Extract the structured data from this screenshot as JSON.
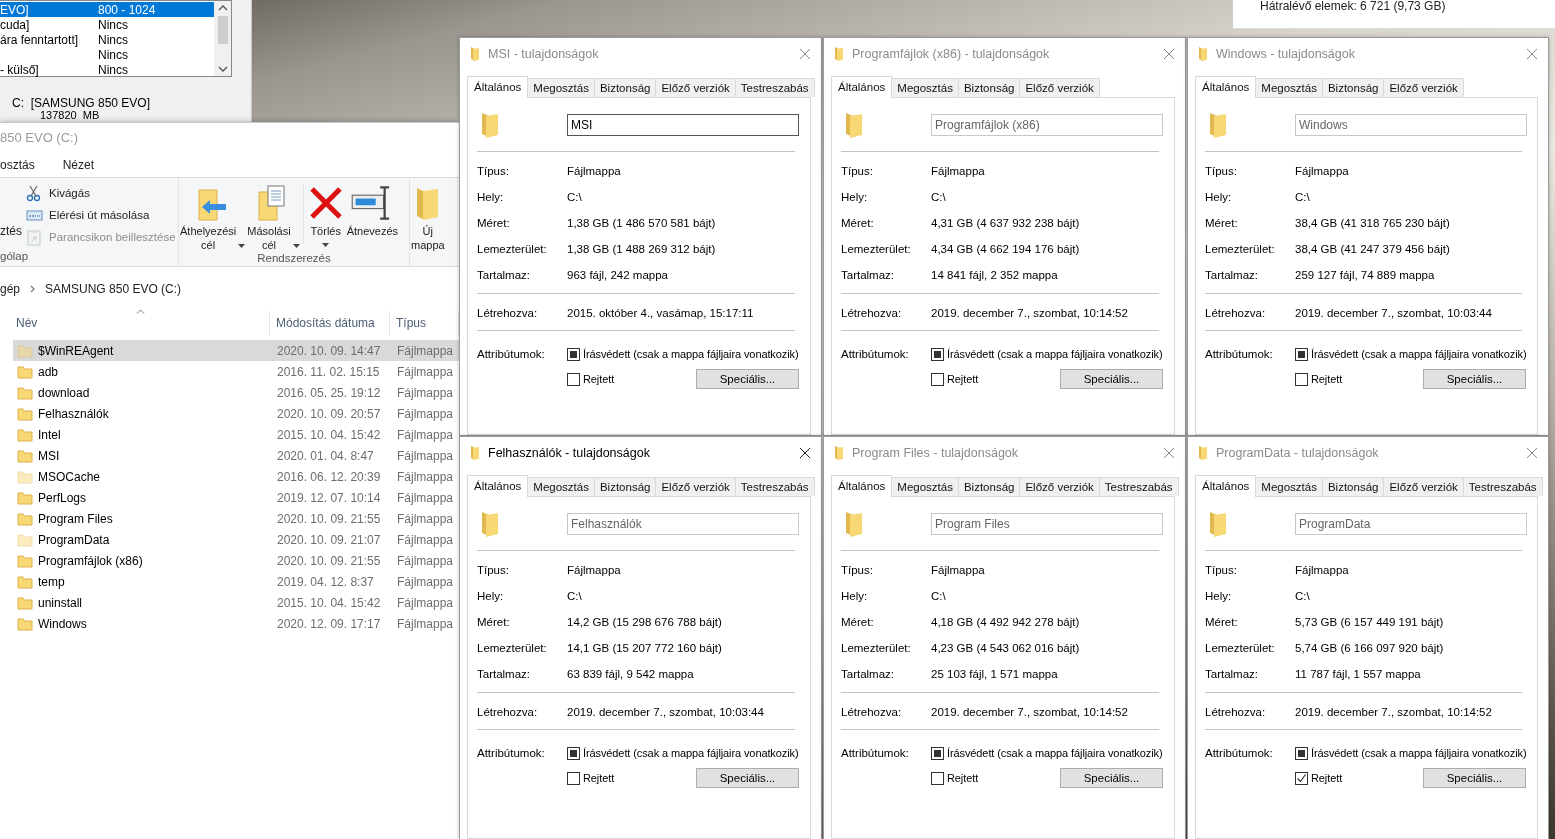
{
  "disk_window": {
    "rows": [
      {
        "column_1": "EVO]",
        "column_2": "800 - 1024",
        "selected": true
      },
      {
        "column_1": "cuda]",
        "column_2": "Nincs",
        "selected": false
      },
      {
        "column_1": "ára fenntartott]",
        "column_2": "Nincs",
        "selected": false
      },
      {
        "column_2": "Nincs",
        "selected": false
      },
      {
        "column_1": "- külső]",
        "column_2": "Nincs",
        "selected": false
      }
    ],
    "drive_label": "C:  [SAMSUNG 850 EVO]",
    "drive_size": "137820  MB"
  },
  "progress_window": {
    "text": "Hátralévő elemek: 6 721 (9,73 GB)"
  },
  "explorer": {
    "title": "850 EVO (C:)",
    "ribbon_tabs": [
      "osztás",
      "Nézet"
    ],
    "ribbon": {
      "clipboard": {
        "partial_button": "ztés",
        "items": [
          {
            "kind": "cut",
            "label": "Kivágás",
            "disabled": false
          },
          {
            "kind": "copy-path",
            "label": "Elérési út másolása",
            "disabled": false
          },
          {
            "kind": "paste-shortcut",
            "label": "Parancsikon beillesztése",
            "disabled": true
          }
        ],
        "group_label": "gólap"
      },
      "organize": {
        "buttons": [
          {
            "kind": "move",
            "label": "Áthelyezési cél",
            "dropdown": true
          },
          {
            "kind": "copy",
            "label": "Másolási cél",
            "dropdown": true
          },
          {
            "kind": "delete",
            "label": "Törlés",
            "dropdown": true
          },
          {
            "kind": "rename",
            "label": "Átnevezés",
            "dropdown": false
          }
        ],
        "group_label": "Rendszerezés"
      },
      "new": {
        "buttons": [
          {
            "kind": "new-folder",
            "label": "Új mappa",
            "dropdown": false
          }
        ]
      }
    },
    "address": [
      "gép",
      "SAMSUNG 850 EVO (C:)"
    ],
    "columns": [
      {
        "label": "Név",
        "sorted": true
      },
      {
        "label": "Módosítás dátuma",
        "sorted": false
      },
      {
        "label": "Típus",
        "sorted": false
      }
    ],
    "rows": [
      {
        "name": "$WinREAgent",
        "date": "2020. 10. 09. 14:47",
        "type": "Fájlmappa",
        "hidden": true,
        "selected": true
      },
      {
        "name": "adb",
        "date": "2016. 11. 02. 15:15",
        "type": "Fájlmappa",
        "hidden": false,
        "selected": false
      },
      {
        "name": "download",
        "date": "2016. 05. 25. 19:12",
        "type": "Fájlmappa",
        "hidden": false,
        "selected": false
      },
      {
        "name": "Felhasználók",
        "date": "2020. 10. 09. 20:57",
        "type": "Fájlmappa",
        "hidden": false,
        "selected": false
      },
      {
        "name": "Intel",
        "date": "2015. 10. 04. 15:42",
        "type": "Fájlmappa",
        "hidden": false,
        "selected": false
      },
      {
        "name": "MSI",
        "date": "2020. 01. 04. 8:47",
        "type": "Fájlmappa",
        "hidden": false,
        "selected": false
      },
      {
        "name": "MSOCache",
        "date": "2016. 06. 12. 20:39",
        "type": "Fájlmappa",
        "hidden": true,
        "selected": false
      },
      {
        "name": "PerfLogs",
        "date": "2019. 12. 07. 10:14",
        "type": "Fájlmappa",
        "hidden": false,
        "selected": false
      },
      {
        "name": "Program Files",
        "date": "2020. 10. 09. 21:55",
        "type": "Fájlmappa",
        "hidden": false,
        "selected": false
      },
      {
        "name": "ProgramData",
        "date": "2020. 10. 09. 21:07",
        "type": "Fájlmappa",
        "hidden": true,
        "selected": false
      },
      {
        "name": "Programfájlok (x86)",
        "date": "2020. 10. 09. 21:55",
        "type": "Fájlmappa",
        "hidden": false,
        "selected": false
      },
      {
        "name": "temp",
        "date": "2019. 04. 12. 8:37",
        "type": "Fájlmappa",
        "hidden": false,
        "selected": false
      },
      {
        "name": "uninstall",
        "date": "2015. 10. 04. 15:42",
        "type": "Fájlmappa",
        "hidden": false,
        "selected": false
      },
      {
        "name": "Windows",
        "date": "2020. 12. 09. 17:17",
        "type": "Fájlmappa",
        "hidden": false,
        "selected": false
      }
    ]
  },
  "dialogs": [
    {
      "title": "MSI - tulajdonságok",
      "active": false,
      "tabs": [
        {
          "label": "Általános",
          "selected": true
        },
        {
          "label": "Megosztás",
          "selected": false
        },
        {
          "label": "Biztonság",
          "selected": false
        },
        {
          "label": "Előző verziók",
          "selected": false
        },
        {
          "label": "Testreszabás",
          "selected": false
        }
      ],
      "name_value": "MSI",
      "name_focused": true,
      "details": [
        {
          "label": "Típus:",
          "value": "Fájlmappa"
        },
        {
          "label": "Hely:",
          "value": "C:\\"
        },
        {
          "label": "Méret:",
          "value": "1,38 GB (1 486 570 581 bájt)"
        },
        {
          "label": "Lemezterület:",
          "value": "1,38 GB (1 488 269 312 bájt)"
        },
        {
          "label": "Tartalmaz:",
          "value": "963 fájl, 242 mappa"
        }
      ],
      "created": {
        "label": "Létrehozva:",
        "value": "2015. október 4., vasámap, 15:17:11"
      },
      "attributes_label": "Attribútumok:",
      "readonly": {
        "label": "Írásvédett (csak a mappa fájljaira vonatkozik)",
        "indeterminate": true
      },
      "hidden_attr": {
        "label": "Rejtett",
        "checked": false
      },
      "advanced_button": "Speciális..."
    },
    {
      "title": "Programfájlok (x86) - tulajdonságok",
      "active": false,
      "tabs": [
        {
          "label": "Általános",
          "selected": true
        },
        {
          "label": "Megosztás",
          "selected": false
        },
        {
          "label": "Biztonság",
          "selected": false
        },
        {
          "label": "Előző verziók",
          "selected": false
        }
      ],
      "name_value": "Programfájlok (x86)",
      "name_focused": false,
      "details": [
        {
          "label": "Típus:",
          "value": "Fájlmappa"
        },
        {
          "label": "Hely:",
          "value": "C:\\"
        },
        {
          "label": "Méret:",
          "value": "4,31 GB (4 637 932 238 bájt)"
        },
        {
          "label": "Lemezterület:",
          "value": "4,34 GB (4 662 194 176 bájt)"
        },
        {
          "label": "Tartalmaz:",
          "value": "14 841 fájl, 2 352 mappa"
        }
      ],
      "created": {
        "label": "Létrehozva:",
        "value": "2019. december 7., szombat, 10:14:52"
      },
      "attributes_label": "Attribútumok:",
      "readonly": {
        "label": "Írásvédett (csak a mappa fájljaira vonatkozik)",
        "indeterminate": true
      },
      "hidden_attr": {
        "label": "Rejtett",
        "checked": false
      },
      "advanced_button": "Speciális..."
    },
    {
      "title": "Windows - tulajdonságok",
      "active": false,
      "tabs": [
        {
          "label": "Általános",
          "selected": true
        },
        {
          "label": "Megosztás",
          "selected": false
        },
        {
          "label": "Biztonság",
          "selected": false
        },
        {
          "label": "Előző verziók",
          "selected": false
        }
      ],
      "name_value": "Windows",
      "name_focused": false,
      "details": [
        {
          "label": "Típus:",
          "value": "Fájlmappa"
        },
        {
          "label": "Hely:",
          "value": "C:\\"
        },
        {
          "label": "Méret:",
          "value": "38,4 GB (41 318 765 230 bájt)"
        },
        {
          "label": "Lemezterület:",
          "value": "38,4 GB (41 247 379 456 bájt)"
        },
        {
          "label": "Tartalmaz:",
          "value": "259 127 fájl, 74 889 mappa"
        }
      ],
      "created": {
        "label": "Létrehozva:",
        "value": "2019. december 7., szombat, 10:03:44"
      },
      "attributes_label": "Attribútumok:",
      "readonly": {
        "label": "Írásvédett (csak a mappa fájljaira vonatkozik)",
        "indeterminate": true
      },
      "hidden_attr": {
        "label": "Rejtett",
        "checked": false
      },
      "advanced_button": "Speciális..."
    },
    {
      "title": "Felhasználók - tulajdonságok",
      "active": true,
      "tabs": [
        {
          "label": "Általános",
          "selected": true
        },
        {
          "label": "Megosztás",
          "selected": false
        },
        {
          "label": "Biztonság",
          "selected": false
        },
        {
          "label": "Előző verziók",
          "selected": false
        },
        {
          "label": "Testreszabás",
          "selected": false
        }
      ],
      "name_value": "Felhasználók",
      "name_focused": false,
      "details": [
        {
          "label": "Típus:",
          "value": "Fájlmappa"
        },
        {
          "label": "Hely:",
          "value": "C:\\"
        },
        {
          "label": "Méret:",
          "value": "14,2 GB (15 298 676 788 bájt)"
        },
        {
          "label": "Lemezterület:",
          "value": "14,1 GB (15 207 772 160 bájt)"
        },
        {
          "label": "Tartalmaz:",
          "value": "63 839 fájl, 9 542 mappa"
        }
      ],
      "created": {
        "label": "Létrehozva:",
        "value": "2019. december 7., szombat, 10:03:44"
      },
      "attributes_label": "Attribútumok:",
      "readonly": {
        "label": "Írásvédett (csak a mappa fájljaira vonatkozik)",
        "indeterminate": true
      },
      "hidden_attr": {
        "label": "Rejtett",
        "checked": false
      },
      "advanced_button": "Speciális..."
    },
    {
      "title": "Program Files - tulajdonságok",
      "active": false,
      "tabs": [
        {
          "label": "Általános",
          "selected": true
        },
        {
          "label": "Megosztás",
          "selected": false
        },
        {
          "label": "Biztonság",
          "selected": false
        },
        {
          "label": "Előző verziók",
          "selected": false
        },
        {
          "label": "Testreszabás",
          "selected": false
        }
      ],
      "name_value": "Program Files",
      "name_focused": false,
      "details": [
        {
          "label": "Típus:",
          "value": "Fájlmappa"
        },
        {
          "label": "Hely:",
          "value": "C:\\"
        },
        {
          "label": "Méret:",
          "value": "4,18 GB (4 492 942 278 bájt)"
        },
        {
          "label": "Lemezterület:",
          "value": "4,23 GB (4 543 062 016 bájt)"
        },
        {
          "label": "Tartalmaz:",
          "value": "25 103 fájl, 1 571 mappa"
        }
      ],
      "created": {
        "label": "Létrehozva:",
        "value": "2019. december 7., szombat, 10:14:52"
      },
      "attributes_label": "Attribútumok:",
      "readonly": {
        "label": "Írásvédett (csak a mappa fájljaira vonatkozik)",
        "indeterminate": true
      },
      "hidden_attr": {
        "label": "Rejtett",
        "checked": false
      },
      "advanced_button": "Speciális..."
    },
    {
      "title": "ProgramData - tulajdonságok",
      "active": false,
      "tabs": [
        {
          "label": "Általános",
          "selected": true
        },
        {
          "label": "Megosztás",
          "selected": false
        },
        {
          "label": "Biztonság",
          "selected": false
        },
        {
          "label": "Előző verziók",
          "selected": false
        },
        {
          "label": "Testreszabás",
          "selected": false
        }
      ],
      "name_value": "ProgramData",
      "name_focused": false,
      "details": [
        {
          "label": "Típus:",
          "value": "Fájlmappa"
        },
        {
          "label": "Hely:",
          "value": "C:\\"
        },
        {
          "label": "Méret:",
          "value": "5,73 GB (6 157 449 191 bájt)"
        },
        {
          "label": "Lemezterület:",
          "value": "5,74 GB (6 166 097 920 bájt)"
        },
        {
          "label": "Tartalmaz:",
          "value": "11 787 fájl, 1 557 mappa"
        }
      ],
      "created": {
        "label": "Létrehozva:",
        "value": "2019. december 7., szombat, 10:14:52"
      },
      "attributes_label": "Attribútumok:",
      "readonly": {
        "label": "Írásvédett (csak a mappa fájljaira vonatkozik)",
        "indeterminate": true
      },
      "hidden_attr": {
        "label": "Rejtett",
        "checked": true
      },
      "advanced_button": "Speciális..."
    }
  ]
}
